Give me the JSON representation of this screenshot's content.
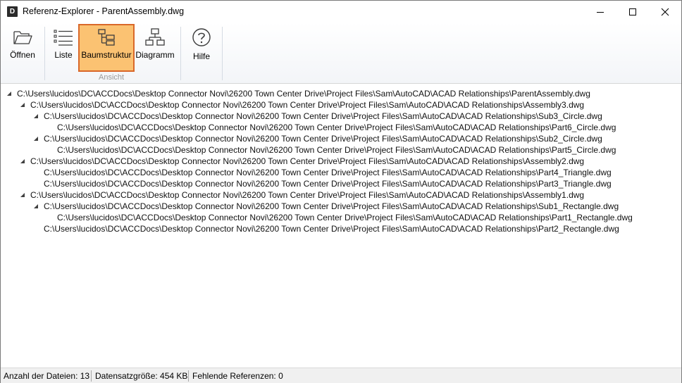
{
  "window": {
    "app_icon_letter": "D",
    "title": "Referenz-Explorer - ParentAssembly.dwg"
  },
  "ribbon": {
    "buttons": [
      {
        "label": "Öffnen",
        "icon": "folder-open-icon"
      },
      {
        "label": "Liste",
        "icon": "list-icon"
      },
      {
        "label": "Baumstruktur",
        "icon": "tree-structure-icon",
        "active": true
      },
      {
        "label": "Diagramm",
        "icon": "diagram-icon"
      },
      {
        "label": "Hilfe",
        "icon": "help-icon"
      }
    ],
    "group_label": "Ansicht",
    "active_color": "#fbc272",
    "active_border": "#d9682a"
  },
  "tree": {
    "rows": [
      {
        "level": 0,
        "expanded": true,
        "path": "C:\\Users\\lucidos\\DC\\ACCDocs\\Desktop Connector Novi\\26200 Town Center Drive\\Project Files\\Sam\\AutoCAD\\ACAD Relationships\\ParentAssembly.dwg"
      },
      {
        "level": 1,
        "expanded": true,
        "path": "C:\\Users\\lucidos\\DC\\ACCDocs\\Desktop Connector Novi\\26200 Town Center Drive\\Project Files\\Sam\\AutoCAD\\ACAD Relationships\\Assembly3.dwg"
      },
      {
        "level": 2,
        "expanded": true,
        "path": "C:\\Users\\lucidos\\DC\\ACCDocs\\Desktop Connector Novi\\26200 Town Center Drive\\Project Files\\Sam\\AutoCAD\\ACAD Relationships\\Sub3_Circle.dwg"
      },
      {
        "level": 3,
        "expanded": false,
        "path": "C:\\Users\\lucidos\\DC\\ACCDocs\\Desktop Connector Novi\\26200 Town Center Drive\\Project Files\\Sam\\AutoCAD\\ACAD Relationships\\Part6_Circle.dwg"
      },
      {
        "level": 2,
        "expanded": true,
        "path": "C:\\Users\\lucidos\\DC\\ACCDocs\\Desktop Connector Novi\\26200 Town Center Drive\\Project Files\\Sam\\AutoCAD\\ACAD Relationships\\Sub2_Circle.dwg"
      },
      {
        "level": 3,
        "expanded": false,
        "path": "C:\\Users\\lucidos\\DC\\ACCDocs\\Desktop Connector Novi\\26200 Town Center Drive\\Project Files\\Sam\\AutoCAD\\ACAD Relationships\\Part5_Circle.dwg"
      },
      {
        "level": 1,
        "expanded": true,
        "path": "C:\\Users\\lucidos\\DC\\ACCDocs\\Desktop Connector Novi\\26200 Town Center Drive\\Project Files\\Sam\\AutoCAD\\ACAD Relationships\\Assembly2.dwg"
      },
      {
        "level": 2,
        "expanded": false,
        "path": "C:\\Users\\lucidos\\DC\\ACCDocs\\Desktop Connector Novi\\26200 Town Center Drive\\Project Files\\Sam\\AutoCAD\\ACAD Relationships\\Part4_Triangle.dwg"
      },
      {
        "level": 2,
        "expanded": false,
        "path": "C:\\Users\\lucidos\\DC\\ACCDocs\\Desktop Connector Novi\\26200 Town Center Drive\\Project Files\\Sam\\AutoCAD\\ACAD Relationships\\Part3_Triangle.dwg"
      },
      {
        "level": 1,
        "expanded": true,
        "path": "C:\\Users\\lucidos\\DC\\ACCDocs\\Desktop Connector Novi\\26200 Town Center Drive\\Project Files\\Sam\\AutoCAD\\ACAD Relationships\\Assembly1.dwg"
      },
      {
        "level": 2,
        "expanded": true,
        "path": "C:\\Users\\lucidos\\DC\\ACCDocs\\Desktop Connector Novi\\26200 Town Center Drive\\Project Files\\Sam\\AutoCAD\\ACAD Relationships\\Sub1_Rectangle.dwg"
      },
      {
        "level": 3,
        "expanded": false,
        "path": "C:\\Users\\lucidos\\DC\\ACCDocs\\Desktop Connector Novi\\26200 Town Center Drive\\Project Files\\Sam\\AutoCAD\\ACAD Relationships\\Part1_Rectangle.dwg"
      },
      {
        "level": 2,
        "expanded": false,
        "path": "C:\\Users\\lucidos\\DC\\ACCDocs\\Desktop Connector Novi\\26200 Town Center Drive\\Project Files\\Sam\\AutoCAD\\ACAD Relationships\\Part2_Rectangle.dwg"
      }
    ]
  },
  "status": {
    "file_count": "Anzahl der Dateien: 13",
    "dataset_size": "Datensatzgröße: 454 KB",
    "missing_refs": "Fehlende Referenzen: 0"
  }
}
